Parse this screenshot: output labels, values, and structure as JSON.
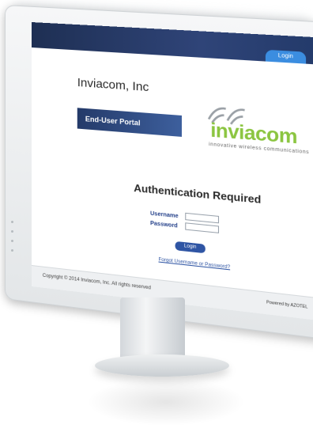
{
  "header": {
    "login_tab": "Login"
  },
  "branding": {
    "company_name": "Inviacom, Inc",
    "portal_label": "End-User Portal",
    "logo_word": "inviacom",
    "logo_tagline": "innovative wireless communications",
    "logo_color": "#8bc540"
  },
  "auth": {
    "title": "Authentication Required",
    "username_label": "Username",
    "password_label": "Password",
    "username_value": "",
    "password_value": "",
    "login_button": "Login",
    "forgot_link": "Forgot Username or Password?"
  },
  "footer": {
    "copyright": "Copyright © 2014 Inviacom, Inc. All rights reserved",
    "powered_by": "Powered by AZOTEL"
  },
  "colors": {
    "topbar": "#1e2f53",
    "banner": "#243a69",
    "button": "#2f55a4",
    "label": "#26428b"
  }
}
